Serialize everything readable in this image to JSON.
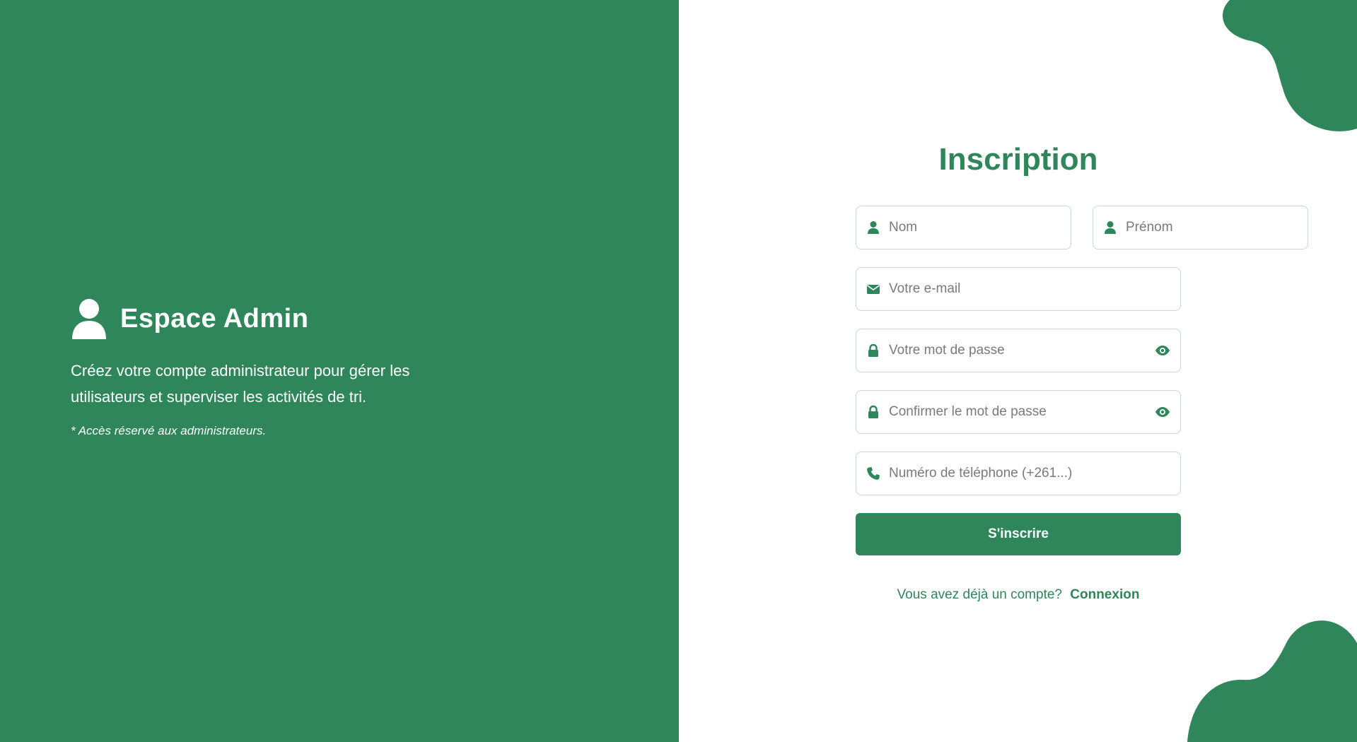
{
  "colors": {
    "brand_green": "#2e865a",
    "white": "#ffffff",
    "input_border": "#cfd6d2",
    "placeholder": "#7a7a7a"
  },
  "left": {
    "icon": "user-icon",
    "title": "Espace Admin",
    "description": "Créez votre compte administrateur pour gérer les utilisateurs et superviser les activités de tri.",
    "note": "* Accès réservé aux administrateurs."
  },
  "form": {
    "title": "Inscription",
    "fields": {
      "nom": {
        "placeholder": "Nom",
        "icon": "user-icon",
        "value": ""
      },
      "prenom": {
        "placeholder": "Prénom",
        "icon": "user-icon",
        "value": ""
      },
      "email": {
        "placeholder": "Votre e-mail",
        "icon": "envelope-icon",
        "value": ""
      },
      "password": {
        "placeholder": "Votre mot de passe",
        "icon": "lock-icon",
        "toggle_icon": "eye-icon",
        "value": ""
      },
      "confirm_password": {
        "placeholder": "Confirmer le mot de passe",
        "icon": "lock-icon",
        "toggle_icon": "eye-icon",
        "value": ""
      },
      "phone": {
        "placeholder": "Numéro de téléphone (+261...)",
        "icon": "phone-icon",
        "value": ""
      }
    },
    "submit_label": "S'inscrire",
    "login_prompt": "Vous avez déjà un compte?",
    "login_link": "Connexion"
  }
}
